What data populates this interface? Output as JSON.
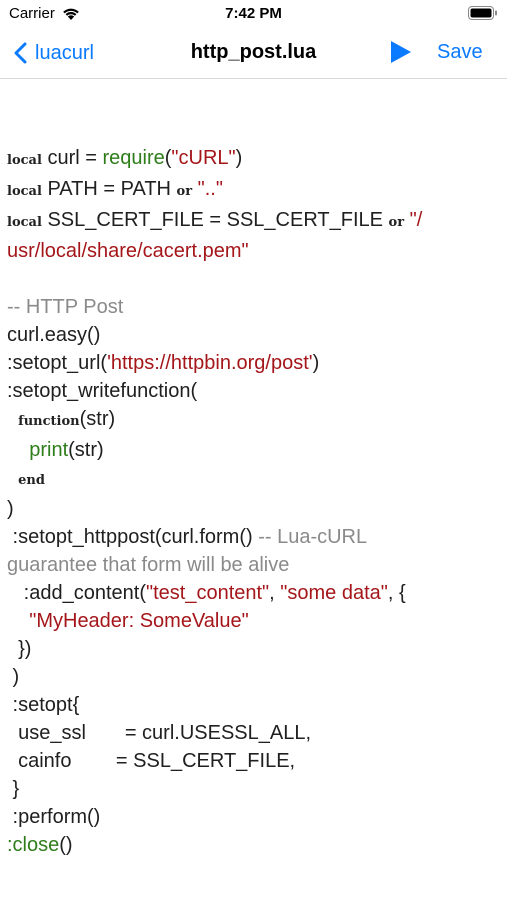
{
  "status": {
    "carrier": "Carrier",
    "time": "7:42 PM"
  },
  "nav": {
    "back_label": "luacurl",
    "title": "http_post.lua",
    "save_label": "Save"
  },
  "code": {
    "l1": {
      "kw": "local",
      "a": " curl = ",
      "fn": "require",
      "b": "(",
      "str": "\"cURL\"",
      "c": ")"
    },
    "l2": {
      "kw": "local",
      "a": " PATH = PATH ",
      "kw2": "or",
      "b": " ",
      "str": "\"..\""
    },
    "l3": {
      "kw": "local",
      "a": " SSL_CERT_FILE = SSL_CERT_FILE ",
      "kw2": "or",
      "b": " ",
      "str": "\"/"
    },
    "l4": {
      "str": "usr/local/share/cacert.pem\""
    },
    "l5": {
      "cmt": "-- HTTP Post"
    },
    "l6": {
      "a": "curl.easy()"
    },
    "l7": {
      "a": " :setopt_url(",
      "str": "'https://httpbin.org/post'",
      "b": ")"
    },
    "l8": {
      "a": " :setopt_writefunction("
    },
    "l9": {
      "pre": "  ",
      "kw": "function",
      "a": "(str)"
    },
    "l10": {
      "pre": "    ",
      "fn": "print",
      "a": "(str)"
    },
    "l11": {
      "pre": "  ",
      "kw": "end"
    },
    "l12": {
      "a": ")"
    },
    "l13": {
      "a": " :setopt_httppost(curl.form() ",
      "cmt": "-- Lua-cURL"
    },
    "l14": {
      "cmt": "guarantee that form will be alive"
    },
    "l15": {
      "a": "   :add_content(",
      "str": "\"test_content\"",
      "b": ", ",
      "str2": "\"some data\"",
      "c": ", {"
    },
    "l16": {
      "pre": "    ",
      "str": "\"MyHeader: SomeValue\""
    },
    "l17": {
      "a": "  })"
    },
    "l18": {
      "a": " )"
    },
    "l19": {
      "a": " :setopt{"
    },
    "l20": {
      "a": "  use_ssl       = curl.USESSL_ALL,"
    },
    "l21": {
      "a": "  cainfo        = SSL_CERT_FILE,"
    },
    "l22": {
      "a": " }"
    },
    "l23": {
      "a": " :perform()"
    },
    "l24": {
      "fn": ":close",
      "a": "()"
    }
  }
}
